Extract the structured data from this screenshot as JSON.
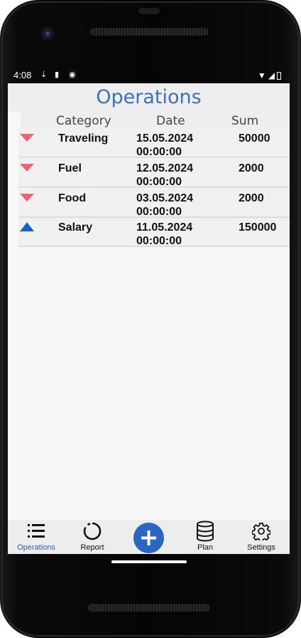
{
  "status": {
    "time": "4:08"
  },
  "header": {
    "title": "Operations"
  },
  "table": {
    "columns": [
      "Category",
      "Date",
      "Sum"
    ],
    "rows": [
      {
        "direction": "expense",
        "category": "Traveling",
        "date": "15.05.2024",
        "time": "00:00:00",
        "sum": "50000"
      },
      {
        "direction": "expense",
        "category": "Fuel",
        "date": "12.05.2024",
        "time": "00:00:00",
        "sum": "2000"
      },
      {
        "direction": "expense",
        "category": "Food",
        "date": "03.05.2024",
        "time": "00:00:00",
        "sum": "2000"
      },
      {
        "direction": "income",
        "category": "Salary",
        "date": "11.05.2024",
        "time": "00:00:00",
        "sum": "150000"
      }
    ]
  },
  "nav": {
    "items": [
      {
        "label": "Operations",
        "icon": "list-icon",
        "active": true
      },
      {
        "label": "Report",
        "icon": "circle-progress-icon",
        "active": false
      },
      {
        "label": "",
        "icon": "add-icon",
        "active": false
      },
      {
        "label": "Plan",
        "icon": "database-icon",
        "active": false
      },
      {
        "label": "Settings",
        "icon": "gear-icon",
        "active": false
      }
    ]
  },
  "colors": {
    "accent": "#3d70b8",
    "expense": "#f06271",
    "income": "#1b64c6",
    "add_button": "#2a66c4"
  }
}
